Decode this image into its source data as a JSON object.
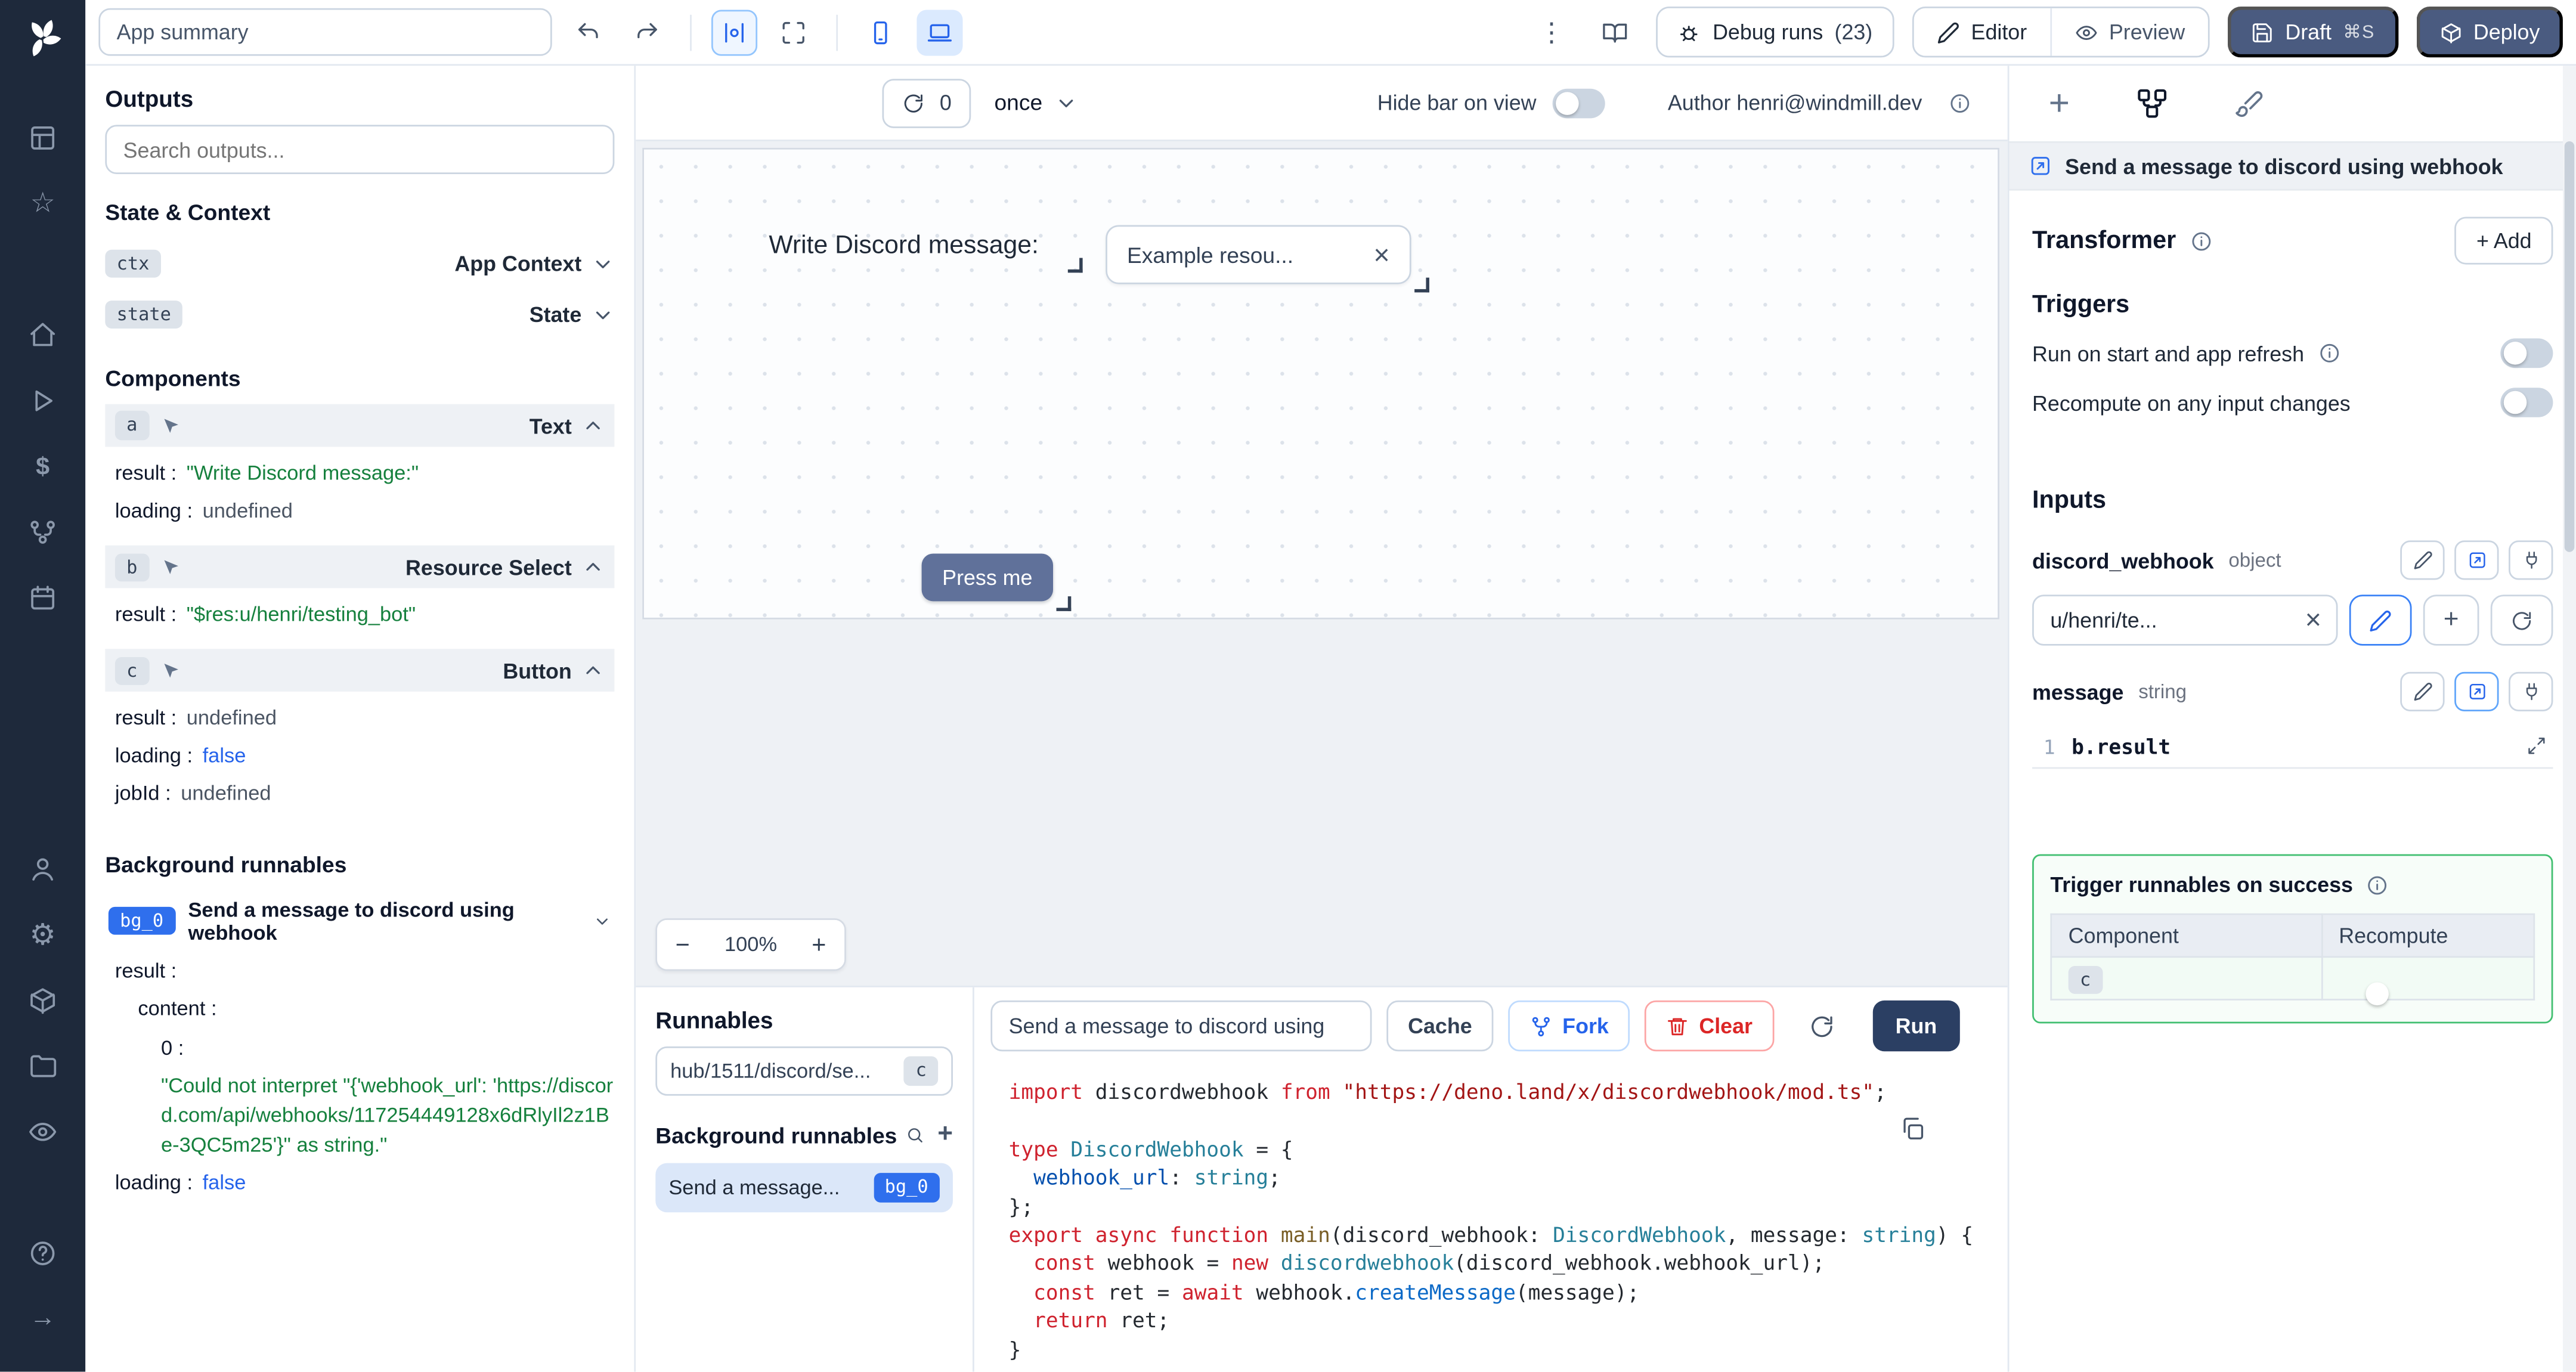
{
  "colors": {
    "accent_blue": "#2f6fed",
    "string_green": "#15803d",
    "error_red": "#dc2626",
    "dark_button": "#4a5b80",
    "sidebar_bg": "#1e293b",
    "success_border": "#41bf70"
  },
  "sidebar": {
    "icons": [
      "windmill-logo",
      "app-grid",
      "star",
      "home",
      "play",
      "dollar",
      "flow",
      "calendar",
      "user",
      "gear",
      "box",
      "folder",
      "eye",
      "help",
      "collapse-arrow"
    ]
  },
  "topbar": {
    "app_summary": "App summary",
    "debug_runs": "Debug runs",
    "debug_count": "(23)",
    "editor": "Editor",
    "preview": "Preview",
    "draft": "Draft",
    "shortcut": "⌘S",
    "deploy": "Deploy"
  },
  "strip": {
    "count": "0",
    "interval": "once",
    "hide_bar": "Hide bar on view",
    "author": "Author henri@windmill.dev"
  },
  "outputs": {
    "title": "Outputs",
    "search_placeholder": "Search outputs...",
    "state_context": "State & Context",
    "ctx_badge": "ctx",
    "ctx_label": "App Context",
    "state_badge": "state",
    "state_label": "State",
    "components": "Components",
    "a_badge": "a",
    "a_type": "Text",
    "b_badge": "b",
    "b_type": "Resource Select",
    "c_badge": "c",
    "c_type": "Button",
    "k_result": "result :",
    "k_loading": "loading :",
    "k_jobid": "jobId :",
    "k_content": "content :",
    "k_zero": "0 :",
    "v_a_result": "\"Write Discord message:\"",
    "v_a_loading": "undefined",
    "v_b_result": "\"$res:u/henri/testing_bot\"",
    "v_c_result": "undefined",
    "v_c_loading": "false",
    "v_c_jobid": "undefined",
    "bg_title": "Background runnables",
    "bg0_badge": "bg_0",
    "bg0_label": "Send a message to discord using webhook",
    "v_bg0_error": "\"Could not interpret \"{'webhook_url': 'https://discord.com/api/webhooks/117254449128x6dRlyIl2z1Be-3QC5m25'}\" as string.\"",
    "v_bg0_loading": "false"
  },
  "canvas": {
    "text_component": "Write Discord message:",
    "select_value": "Example resou...",
    "button_label": "Press me",
    "zoom_out": "−",
    "zoom_value": "100%",
    "zoom_in": "+"
  },
  "runnables": {
    "title": "Runnables",
    "item_label": "hub/1511/discord/se...",
    "item_badge": "c",
    "bg_title": "Background runnables",
    "bg_item_label": "Send a message...",
    "bg_item_badge": "bg_0"
  },
  "editor": {
    "script_name": "Send a message to discord using",
    "cache": "Cache",
    "fork": "Fork",
    "clear": "Clear",
    "run": "Run",
    "code_lines": [
      [
        [
          "kw",
          "import"
        ],
        [
          "pl",
          " discordwebhook "
        ],
        [
          "kw",
          "from"
        ],
        [
          "pl",
          " "
        ],
        [
          "str",
          "\"https://deno.land/x/discordwebhook/mod.ts\""
        ],
        [
          "pl",
          ";"
        ]
      ],
      [],
      [
        [
          "kw",
          "type"
        ],
        [
          "pl",
          " "
        ],
        [
          "typ",
          "DiscordWebhook"
        ],
        [
          "pl",
          " = {"
        ]
      ],
      [
        [
          "pl",
          "  "
        ],
        [
          "prop",
          "webhook_url"
        ],
        [
          "pl",
          ": "
        ],
        [
          "typ",
          "string"
        ],
        [
          "pl",
          ";"
        ]
      ],
      [
        [
          "pl",
          "};"
        ]
      ],
      [
        [
          "kw",
          "export"
        ],
        [
          "pl",
          " "
        ],
        [
          "kw",
          "async"
        ],
        [
          "pl",
          " "
        ],
        [
          "kw",
          "function"
        ],
        [
          "pl",
          " "
        ],
        [
          "def",
          "main"
        ],
        [
          "pl",
          "(discord_webhook: "
        ],
        [
          "typ",
          "DiscordWebhook"
        ],
        [
          "pl",
          ", message: "
        ],
        [
          "typ",
          "string"
        ],
        [
          "pl",
          ") {"
        ]
      ],
      [
        [
          "pl",
          "  "
        ],
        [
          "kw",
          "const"
        ],
        [
          "pl",
          " webhook = "
        ],
        [
          "kw",
          "new"
        ],
        [
          "pl",
          " "
        ],
        [
          "typ",
          "discordwebhook"
        ],
        [
          "pl",
          "(discord_webhook.webhook_url);"
        ]
      ],
      [
        [
          "pl",
          "  "
        ],
        [
          "kw",
          "const"
        ],
        [
          "pl",
          " ret = "
        ],
        [
          "kw",
          "await"
        ],
        [
          "pl",
          " webhook."
        ],
        [
          "fn",
          "createMessage"
        ],
        [
          "pl",
          "(message);"
        ]
      ],
      [
        [
          "pl",
          "  "
        ],
        [
          "kw",
          "return"
        ],
        [
          "pl",
          " ret;"
        ]
      ],
      [
        [
          "pl",
          "}"
        ]
      ]
    ]
  },
  "inspector": {
    "header": "Send a message to discord using webhook",
    "transformer": "Transformer",
    "add": "+ Add",
    "triggers": "Triggers",
    "trigger_start": "Run on start and app refresh",
    "trigger_recompute": "Recompute on any input changes",
    "inputs": "Inputs",
    "input1_name": "discord_webhook",
    "input1_type": "object",
    "input1_value": "u/henri/te...",
    "input2_name": "message",
    "input2_type": "string",
    "expr_line": "1",
    "expr_value": "b.result",
    "success_title": "Trigger runnables on success",
    "col_component": "Component",
    "col_recompute": "Recompute",
    "row_badge": "c"
  }
}
